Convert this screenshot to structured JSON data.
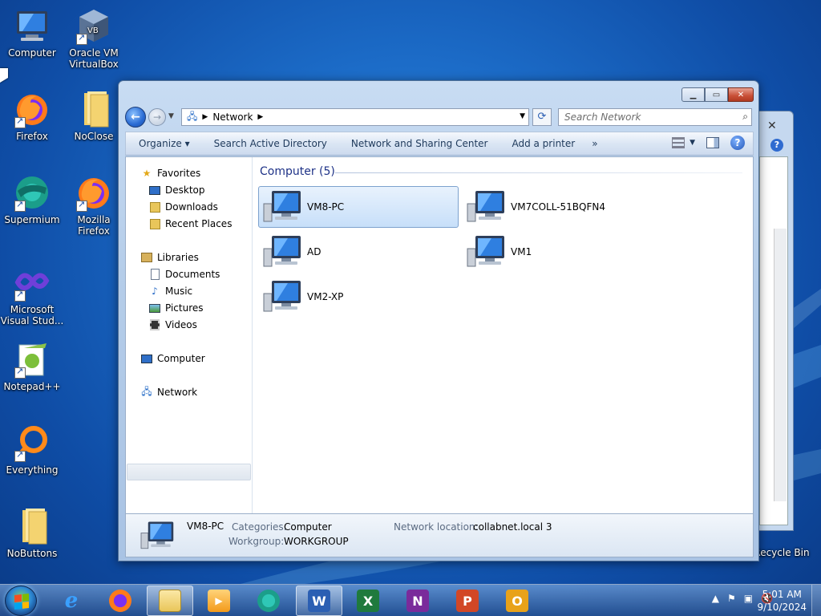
{
  "desktop": {
    "icons": [
      {
        "label": "Computer"
      },
      {
        "label": "Oracle VM VirtualBox"
      },
      {
        "label": "Firefox"
      },
      {
        "label": "NoClose"
      },
      {
        "label": "Supermium"
      },
      {
        "label": "Mozilla Firefox"
      },
      {
        "label": "Microsoft Visual Stud..."
      },
      {
        "label": "Notepad++"
      },
      {
        "label": "Everything"
      },
      {
        "label": "NoButtons"
      },
      {
        "label": "Recycle Bin"
      }
    ]
  },
  "explorer": {
    "address": {
      "crumb": "Network"
    },
    "search": {
      "placeholder": "Search Network"
    },
    "toolbar": {
      "organize": "Organize",
      "search_ad": "Search Active Directory",
      "sharing_center": "Network and Sharing Center",
      "add_printer": "Add a printer",
      "more": "»"
    },
    "nav": {
      "favorites": "Favorites",
      "desktop": "Desktop",
      "downloads": "Downloads",
      "recent": "Recent Places",
      "libraries": "Libraries",
      "documents": "Documents",
      "music": "Music",
      "pictures": "Pictures",
      "videos": "Videos",
      "computer": "Computer",
      "network": "Network"
    },
    "group": {
      "header": "Computer (5)"
    },
    "computers": [
      {
        "name": "VM8-PC"
      },
      {
        "name": "VM7COLL-51BQFN4"
      },
      {
        "name": "AD"
      },
      {
        "name": "VM1"
      },
      {
        "name": "VM2-XP"
      }
    ],
    "details": {
      "name": "VM8-PC",
      "categories_label": "Categories:",
      "categories_value": "Computer",
      "workgroup_label": "Workgroup:",
      "workgroup_value": "WORKGROUP",
      "location_label": "Network location:",
      "location_value": "collabnet.local 3"
    }
  },
  "taskbar": {
    "time": "5:01 AM",
    "date": "9/10/2024"
  }
}
